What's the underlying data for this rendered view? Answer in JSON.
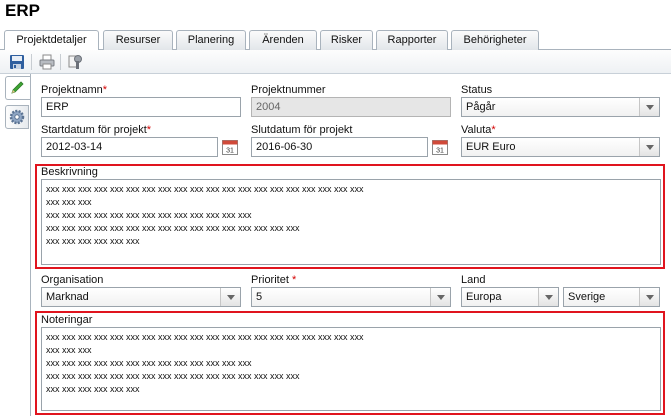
{
  "app": {
    "title": "ERP"
  },
  "tabs": [
    {
      "label": "Projektdetaljer",
      "active": true
    },
    {
      "label": "Resurser"
    },
    {
      "label": "Planering"
    },
    {
      "label": "Ärenden"
    },
    {
      "label": "Risker"
    },
    {
      "label": "Rapporter"
    },
    {
      "label": "Behörigheter"
    }
  ],
  "toolbar": {
    "icons": [
      "save-icon",
      "print-icon",
      "settings-tools-icon"
    ]
  },
  "sidebar": {
    "icons": [
      "pencil-edit-icon",
      "gear-icon"
    ]
  },
  "form": {
    "project_name": {
      "label": "Projektnamn",
      "required_mark": "*",
      "value": "ERP"
    },
    "project_number": {
      "label": "Projektnummer",
      "value": "2004"
    },
    "status": {
      "label": "Status",
      "value": "Pågår"
    },
    "start_date": {
      "label": "Startdatum för projekt",
      "required_mark": "*",
      "value": "2012-03-14",
      "cal_day": "31"
    },
    "end_date": {
      "label": "Slutdatum för projekt",
      "value": "2016-06-30",
      "cal_day": "31"
    },
    "currency": {
      "label": "Valuta",
      "required_mark": "*",
      "value": "EUR Euro"
    },
    "description": {
      "label": "Beskrivning",
      "lines": [
        "xxx xxx xxx xxx xxx xxx xxx xxx xxx xxx xxx xxx xxx xxx xxx xxx xxx xxx xxx xxx",
        "xxx xxx xxx",
        "xxx xxx xxx xxx xxx xxx xxx xxx xxx xxx xxx xxx xxx",
        "xxx xxx xxx xxx xxx xxx xxx xxx xxx xxx xxx xxx xxx xxx xxx xxx",
        "xxx xxx xxx xxx xxx xxx"
      ]
    },
    "organisation": {
      "label": "Organisation",
      "value": "Marknad"
    },
    "priority": {
      "label": "Prioritet",
      "required_mark": "*",
      "value": "5"
    },
    "country": {
      "label": "Land",
      "region_value": "Europa",
      "country_value": "Sverige"
    },
    "notes": {
      "label": "Noteringar",
      "lines": [
        "xxx xxx xxx xxx xxx xxx xxx xxx xxx xxx xxx xxx xxx xxx xxx xxx xxx xxx xxx xxx",
        "xxx xxx xxx",
        "xxx xxx xxx xxx xxx xxx xxx xxx xxx xxx xxx xxx xxx",
        "xxx xxx xxx xxx xxx xxx xxx xxx xxx xxx xxx xxx xxx xxx xxx xxx",
        "xxx xxx xxx xxx xxx xxx"
      ]
    }
  },
  "colors": {
    "highlight": "#e0141e",
    "required": "#d40000",
    "tab_border": "#a9b3bd"
  }
}
